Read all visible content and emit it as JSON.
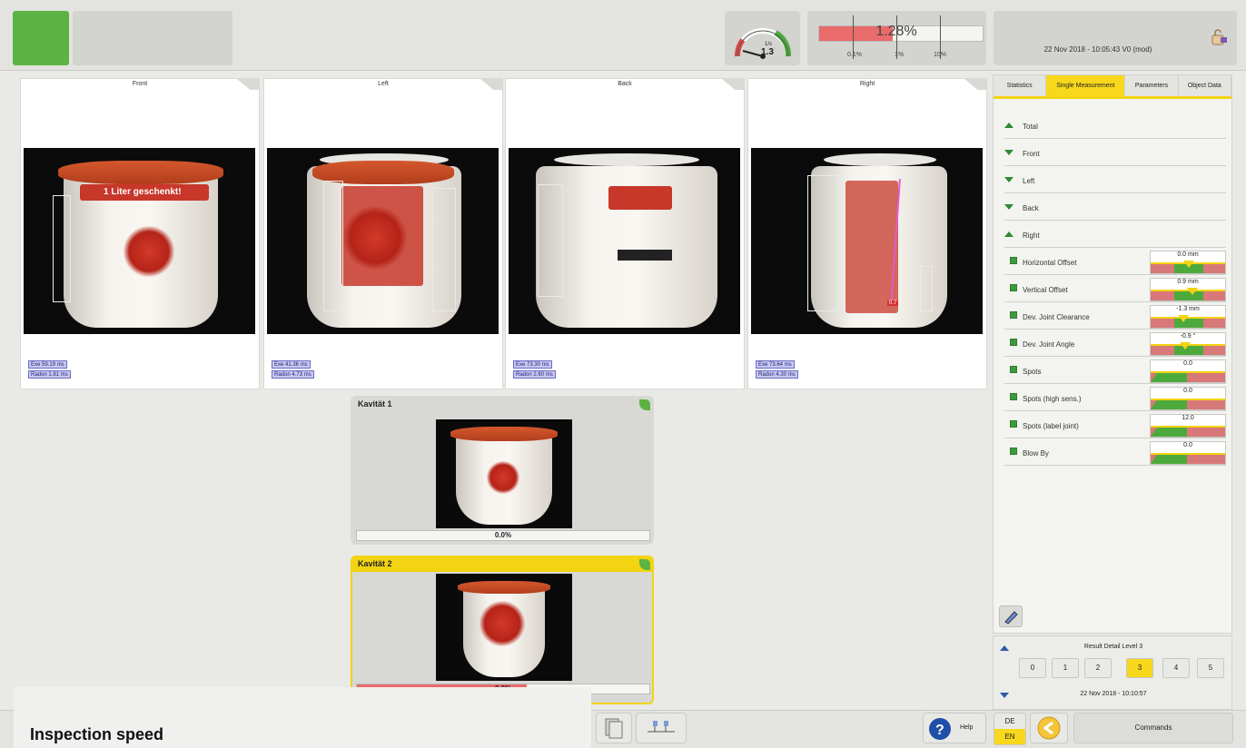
{
  "gauge": {
    "unit": "1/s",
    "value": "1.3"
  },
  "reject_rate": {
    "value": "1.28%",
    "fraction": 0.45,
    "ticks": [
      "0.1%",
      "1%",
      "10%"
    ]
  },
  "header_info": {
    "datetime": "22 Nov 2018 - 10:05:43",
    "version": "V0 (mod)"
  },
  "cameras": [
    {
      "title": "Front",
      "exe": "Exe 59.19 ms",
      "radon": "Radon 1.81 ms"
    },
    {
      "title": "Left",
      "exe": "Exe 41.36 ms",
      "radon": "Radon 4.73 ms"
    },
    {
      "title": "Back",
      "exe": "Exe 73.30 ms",
      "radon": "Radon 2.60 ms"
    },
    {
      "title": "Right",
      "exe": "Exe 73.64 ms",
      "radon": "Radon 4.30 ms"
    }
  ],
  "image_text": {
    "front_label": "1 Liter geschenkt!",
    "right_badge": "0.7"
  },
  "cavities": [
    {
      "title": "Kavität 1",
      "percent": "0.0%"
    },
    {
      "title": "Kavität 2",
      "percent": "2.0%"
    }
  ],
  "side_tabs": [
    "Statistics",
    "Single Measurement",
    "Parameters",
    "Object Data"
  ],
  "sections": [
    {
      "label": "Total",
      "state": "up"
    },
    {
      "label": "Front",
      "state": "down"
    },
    {
      "label": "Left",
      "state": "down"
    },
    {
      "label": "Back",
      "state": "down"
    },
    {
      "label": "Right",
      "state": "up"
    }
  ],
  "measurements": [
    {
      "label": "Horizontal Offset",
      "value": "0.0 mm"
    },
    {
      "label": "Vertical Offset",
      "value": "0.9 mm"
    },
    {
      "label": "Dev. Joint Clearance",
      "value": "-1.3 mm"
    },
    {
      "label": "Dev. Joint Angle",
      "value": "-0.9 °"
    },
    {
      "label": "Spots",
      "value": "0.0"
    },
    {
      "label": "Spots (high sens.)",
      "value": "0.0"
    },
    {
      "label": "Spots (label joint)",
      "value": "12.0"
    },
    {
      "label": "Blow By",
      "value": "0.0"
    }
  ],
  "result": {
    "title": "Result Detail Level 3",
    "levels": [
      "0",
      "1",
      "2",
      "3",
      "4",
      "5"
    ],
    "datetime": "22 Nov 2018 - 10:10:57"
  },
  "footer": {
    "help": "Help",
    "lang_de": "DE",
    "lang_en": "EN",
    "commands": "Commands"
  },
  "caption": "Inspection speed",
  "colors": {
    "ok": "#5cb343",
    "accent": "#f7d81c",
    "reject": "#e96b6b"
  }
}
